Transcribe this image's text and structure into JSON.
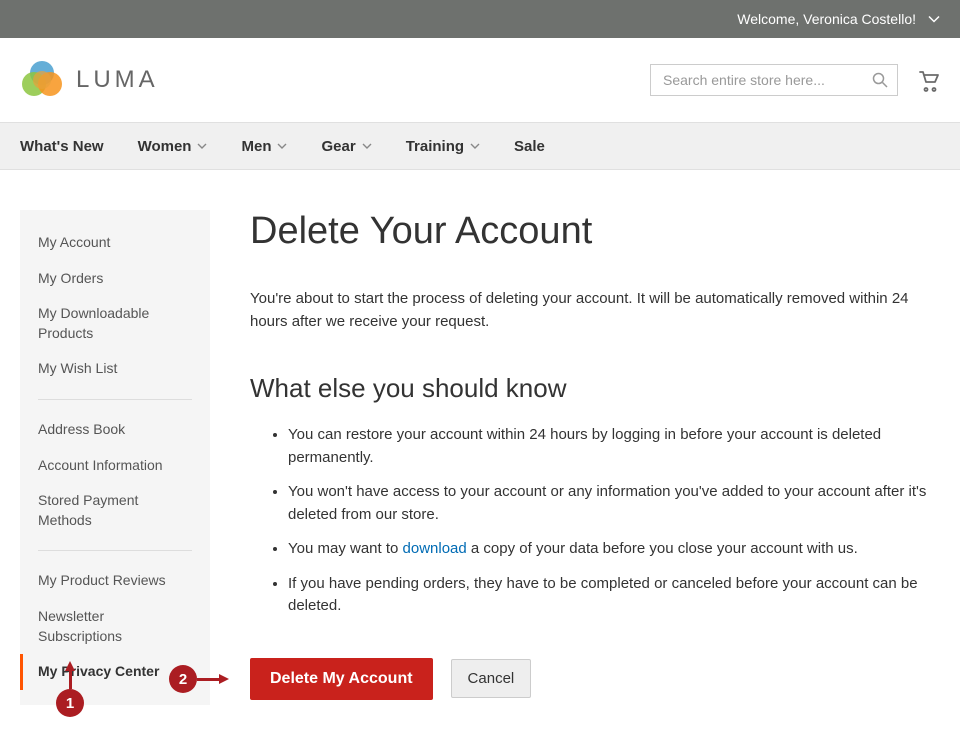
{
  "header": {
    "welcome": "Welcome, Veronica Costello!"
  },
  "logo": {
    "text": "LUMA"
  },
  "search": {
    "placeholder": "Search entire store here..."
  },
  "nav": [
    {
      "label": "What's New",
      "has_chevron": false
    },
    {
      "label": "Women",
      "has_chevron": true
    },
    {
      "label": "Men",
      "has_chevron": true
    },
    {
      "label": "Gear",
      "has_chevron": true
    },
    {
      "label": "Training",
      "has_chevron": true
    },
    {
      "label": "Sale",
      "has_chevron": false
    }
  ],
  "sidebar": {
    "group1": [
      "My Account",
      "My Orders",
      "My Downloadable Products",
      "My Wish List"
    ],
    "group2": [
      "Address Book",
      "Account Information",
      "Stored Payment Methods"
    ],
    "group3": [
      "My Product Reviews",
      "Newsletter Subscriptions",
      "My Privacy Center"
    ]
  },
  "main": {
    "title": "Delete Your Account",
    "intro": "You're about to start the process of deleting your account. It will be automatically removed within 24 hours after we receive your request.",
    "subheading": "What else you should know",
    "bullets": {
      "b1": "You can restore your account within 24 hours by logging in before your account is deleted permanently.",
      "b2": "You won't have access to your account or any information you've added to your account after it's deleted from our store.",
      "b3_pre": "You may want to ",
      "b3_link": "download",
      "b3_post": " a copy of your data before you close your account with us.",
      "b4": "If you have pending orders, they have to be completed or canceled before your account can be deleted."
    },
    "buttons": {
      "primary": "Delete My Account",
      "secondary": "Cancel"
    }
  },
  "annotations": {
    "one": "1",
    "two": "2"
  }
}
